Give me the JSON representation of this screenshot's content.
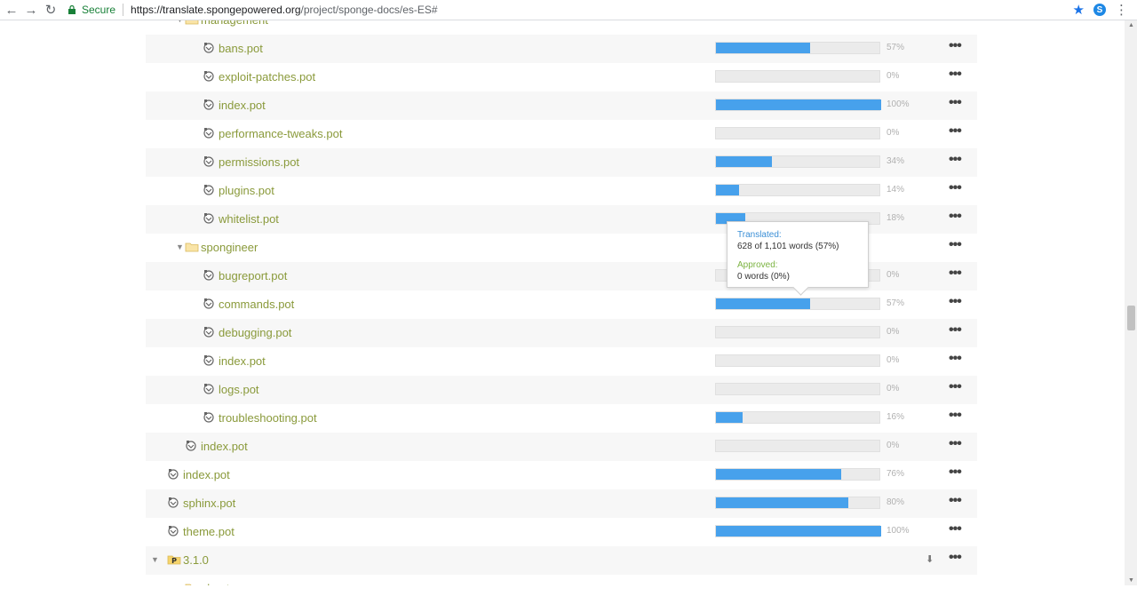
{
  "browser": {
    "secure_label": "Secure",
    "url_host": "https://translate.spongepowered.org",
    "url_path": "/project/sponge-docs/es-ES#"
  },
  "rows": [
    {
      "label": "management",
      "type": "folder",
      "indent": 1,
      "caret": true,
      "partial": "top"
    },
    {
      "label": "bans.pot",
      "type": "file",
      "indent": 2,
      "pct": 57,
      "pct_label": "57%"
    },
    {
      "label": "exploit-patches.pot",
      "type": "file",
      "indent": 2,
      "pct": 0,
      "pct_label": "0%"
    },
    {
      "label": "index.pot",
      "type": "file",
      "indent": 2,
      "pct": 100,
      "pct_label": "100%"
    },
    {
      "label": "performance-tweaks.pot",
      "type": "file",
      "indent": 2,
      "pct": 0,
      "pct_label": "0%"
    },
    {
      "label": "permissions.pot",
      "type": "file",
      "indent": 2,
      "pct": 34,
      "pct_label": "34%"
    },
    {
      "label": "plugins.pot",
      "type": "file",
      "indent": 2,
      "pct": 14,
      "pct_label": "14%"
    },
    {
      "label": "whitelist.pot",
      "type": "file",
      "indent": 2,
      "pct": 18,
      "pct_label": "18%"
    },
    {
      "label": "spongineer",
      "type": "folder",
      "indent": 1,
      "caret": true
    },
    {
      "label": "bugreport.pot",
      "type": "file",
      "indent": 2,
      "pct": 0,
      "pct_label": "0%"
    },
    {
      "label": "commands.pot",
      "type": "file",
      "indent": 2,
      "pct": 57,
      "pct_label": "57%"
    },
    {
      "label": "debugging.pot",
      "type": "file",
      "indent": 2,
      "pct": 0,
      "pct_label": "0%"
    },
    {
      "label": "index.pot",
      "type": "file",
      "indent": 2,
      "pct": 0,
      "pct_label": "0%"
    },
    {
      "label": "logs.pot",
      "type": "file",
      "indent": 2,
      "pct": 0,
      "pct_label": "0%"
    },
    {
      "label": "troubleshooting.pot",
      "type": "file",
      "indent": 2,
      "pct": 16,
      "pct_label": "16%"
    },
    {
      "label": "index.pot",
      "type": "file",
      "indent": 1,
      "pct": 0,
      "pct_label": "0%"
    },
    {
      "label": "index.pot",
      "type": "file",
      "indent": 0,
      "pct": 76,
      "pct_label": "76%"
    },
    {
      "label": "sphinx.pot",
      "type": "file",
      "indent": 0,
      "pct": 80,
      "pct_label": "80%"
    },
    {
      "label": "theme.pot",
      "type": "file",
      "indent": 0,
      "pct": 100,
      "pct_label": "100%"
    },
    {
      "label": "3.1.0",
      "type": "version",
      "indent": 0,
      "caret": true,
      "download": true
    },
    {
      "label": "about",
      "type": "folder",
      "indent": 1,
      "partial": "bottom"
    }
  ],
  "tooltip": {
    "translated_heading": "Translated:",
    "translated_value": "628 of 1,101 words (57%)",
    "approved_heading": "Approved:",
    "approved_value": "0 words (0%)"
  },
  "colors": {
    "bar_fill": "#47a1ec",
    "label": "#8a9a3b",
    "row_alt": "#f7f7f7"
  }
}
